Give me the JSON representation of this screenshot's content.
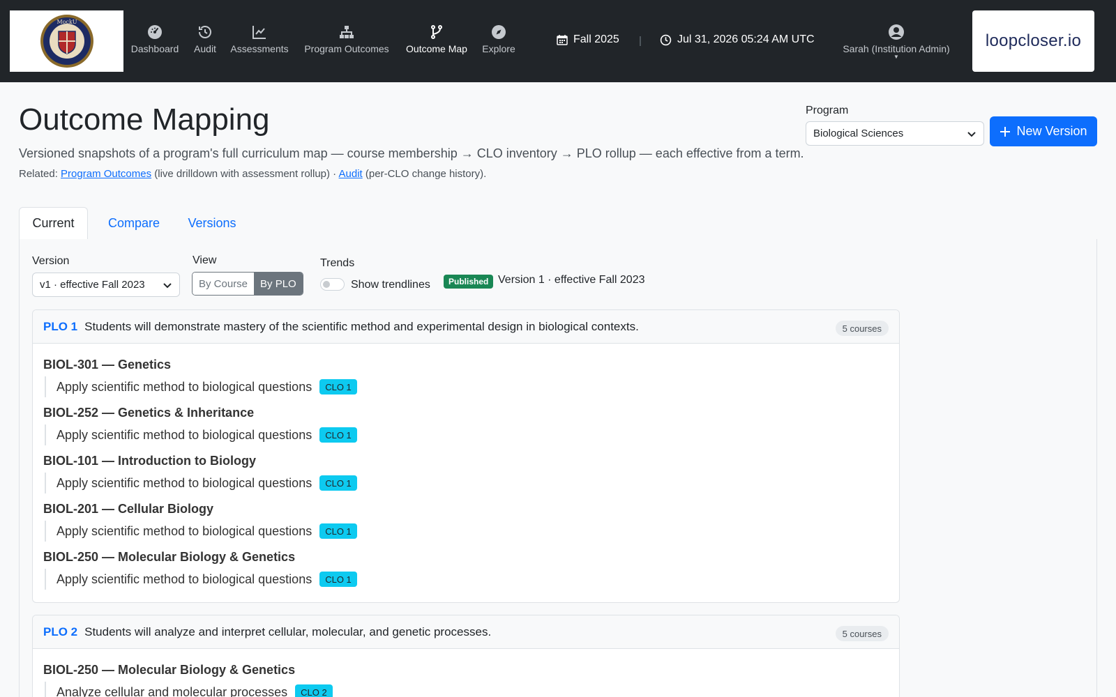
{
  "nav": {
    "items": [
      {
        "label": "Dashboard",
        "icon": "dashboard-gauge-icon"
      },
      {
        "label": "Audit",
        "icon": "history-icon"
      },
      {
        "label": "Assessments",
        "icon": "chart-line-icon"
      },
      {
        "label": "Program Outcomes",
        "icon": "hierarchy-icon"
      },
      {
        "label": "Outcome Map",
        "icon": "branch-icon"
      },
      {
        "label": "Explore",
        "icon": "compass-icon"
      }
    ],
    "active": "Outcome Map",
    "term": "Fall 2025",
    "separator": "|",
    "datetime": "Jul 31, 2026 05:24 AM UTC",
    "user": "Sarah (Institution Admin)",
    "brand_right": "loopcloser.io",
    "brand_left_logo": "MockU"
  },
  "header": {
    "title": "Outcome Mapping",
    "subtitle": "Versioned snapshots of a program's full curriculum map — course membership → CLO inventory → PLO rollup — each effective from a term.",
    "related_prefix": "Related: ",
    "related_link1": "Program Outcomes",
    "related_mid": " (live drilldown with assessment rollup) · ",
    "related_link2": "Audit",
    "related_suffix": " (per-CLO change history).",
    "program_label": "Program",
    "program_value": "Biological Sciences",
    "new_version_label": "New Version"
  },
  "tabs": [
    "Current",
    "Compare",
    "Versions"
  ],
  "controls": {
    "version_label": "Version",
    "version_value": "v1 · effective Fall 2023",
    "view_label": "View",
    "view_options": [
      "By Course",
      "By PLO"
    ],
    "view_selected": "By PLO",
    "trends_label": "Trends",
    "trends_toggle_label": "Show trendlines",
    "trends_on": false,
    "status_badge": "Published",
    "version_info": "Version 1 · effective Fall 2023"
  },
  "plos": [
    {
      "code": "PLO 1",
      "text": "Students will demonstrate mastery of the scientific method and experimental design in biological contexts.",
      "count": "5 courses",
      "courses": [
        {
          "title": "BIOL-301 — Genetics",
          "clo_text": "Apply scientific method to biological questions",
          "clo_code": "CLO 1"
        },
        {
          "title": "BIOL-252 — Genetics & Inheritance",
          "clo_text": "Apply scientific method to biological questions",
          "clo_code": "CLO 1"
        },
        {
          "title": "BIOL-101 — Introduction to Biology",
          "clo_text": "Apply scientific method to biological questions",
          "clo_code": "CLO 1"
        },
        {
          "title": "BIOL-201 — Cellular Biology",
          "clo_text": "Apply scientific method to biological questions",
          "clo_code": "CLO 1"
        },
        {
          "title": "BIOL-250 — Molecular Biology & Genetics",
          "clo_text": "Apply scientific method to biological questions",
          "clo_code": "CLO 1"
        }
      ]
    },
    {
      "code": "PLO 2",
      "text": "Students will analyze and interpret cellular, molecular, and genetic processes.",
      "count": "5 courses",
      "courses": [
        {
          "title": "BIOL-250 — Molecular Biology & Genetics",
          "clo_text": "Analyze cellular and molecular processes",
          "clo_code": "CLO 2"
        }
      ]
    }
  ],
  "colors": {
    "navbar": "#212529",
    "primary": "#0d6efd",
    "published": "#198754",
    "clo_badge": "#0dcaf0"
  }
}
